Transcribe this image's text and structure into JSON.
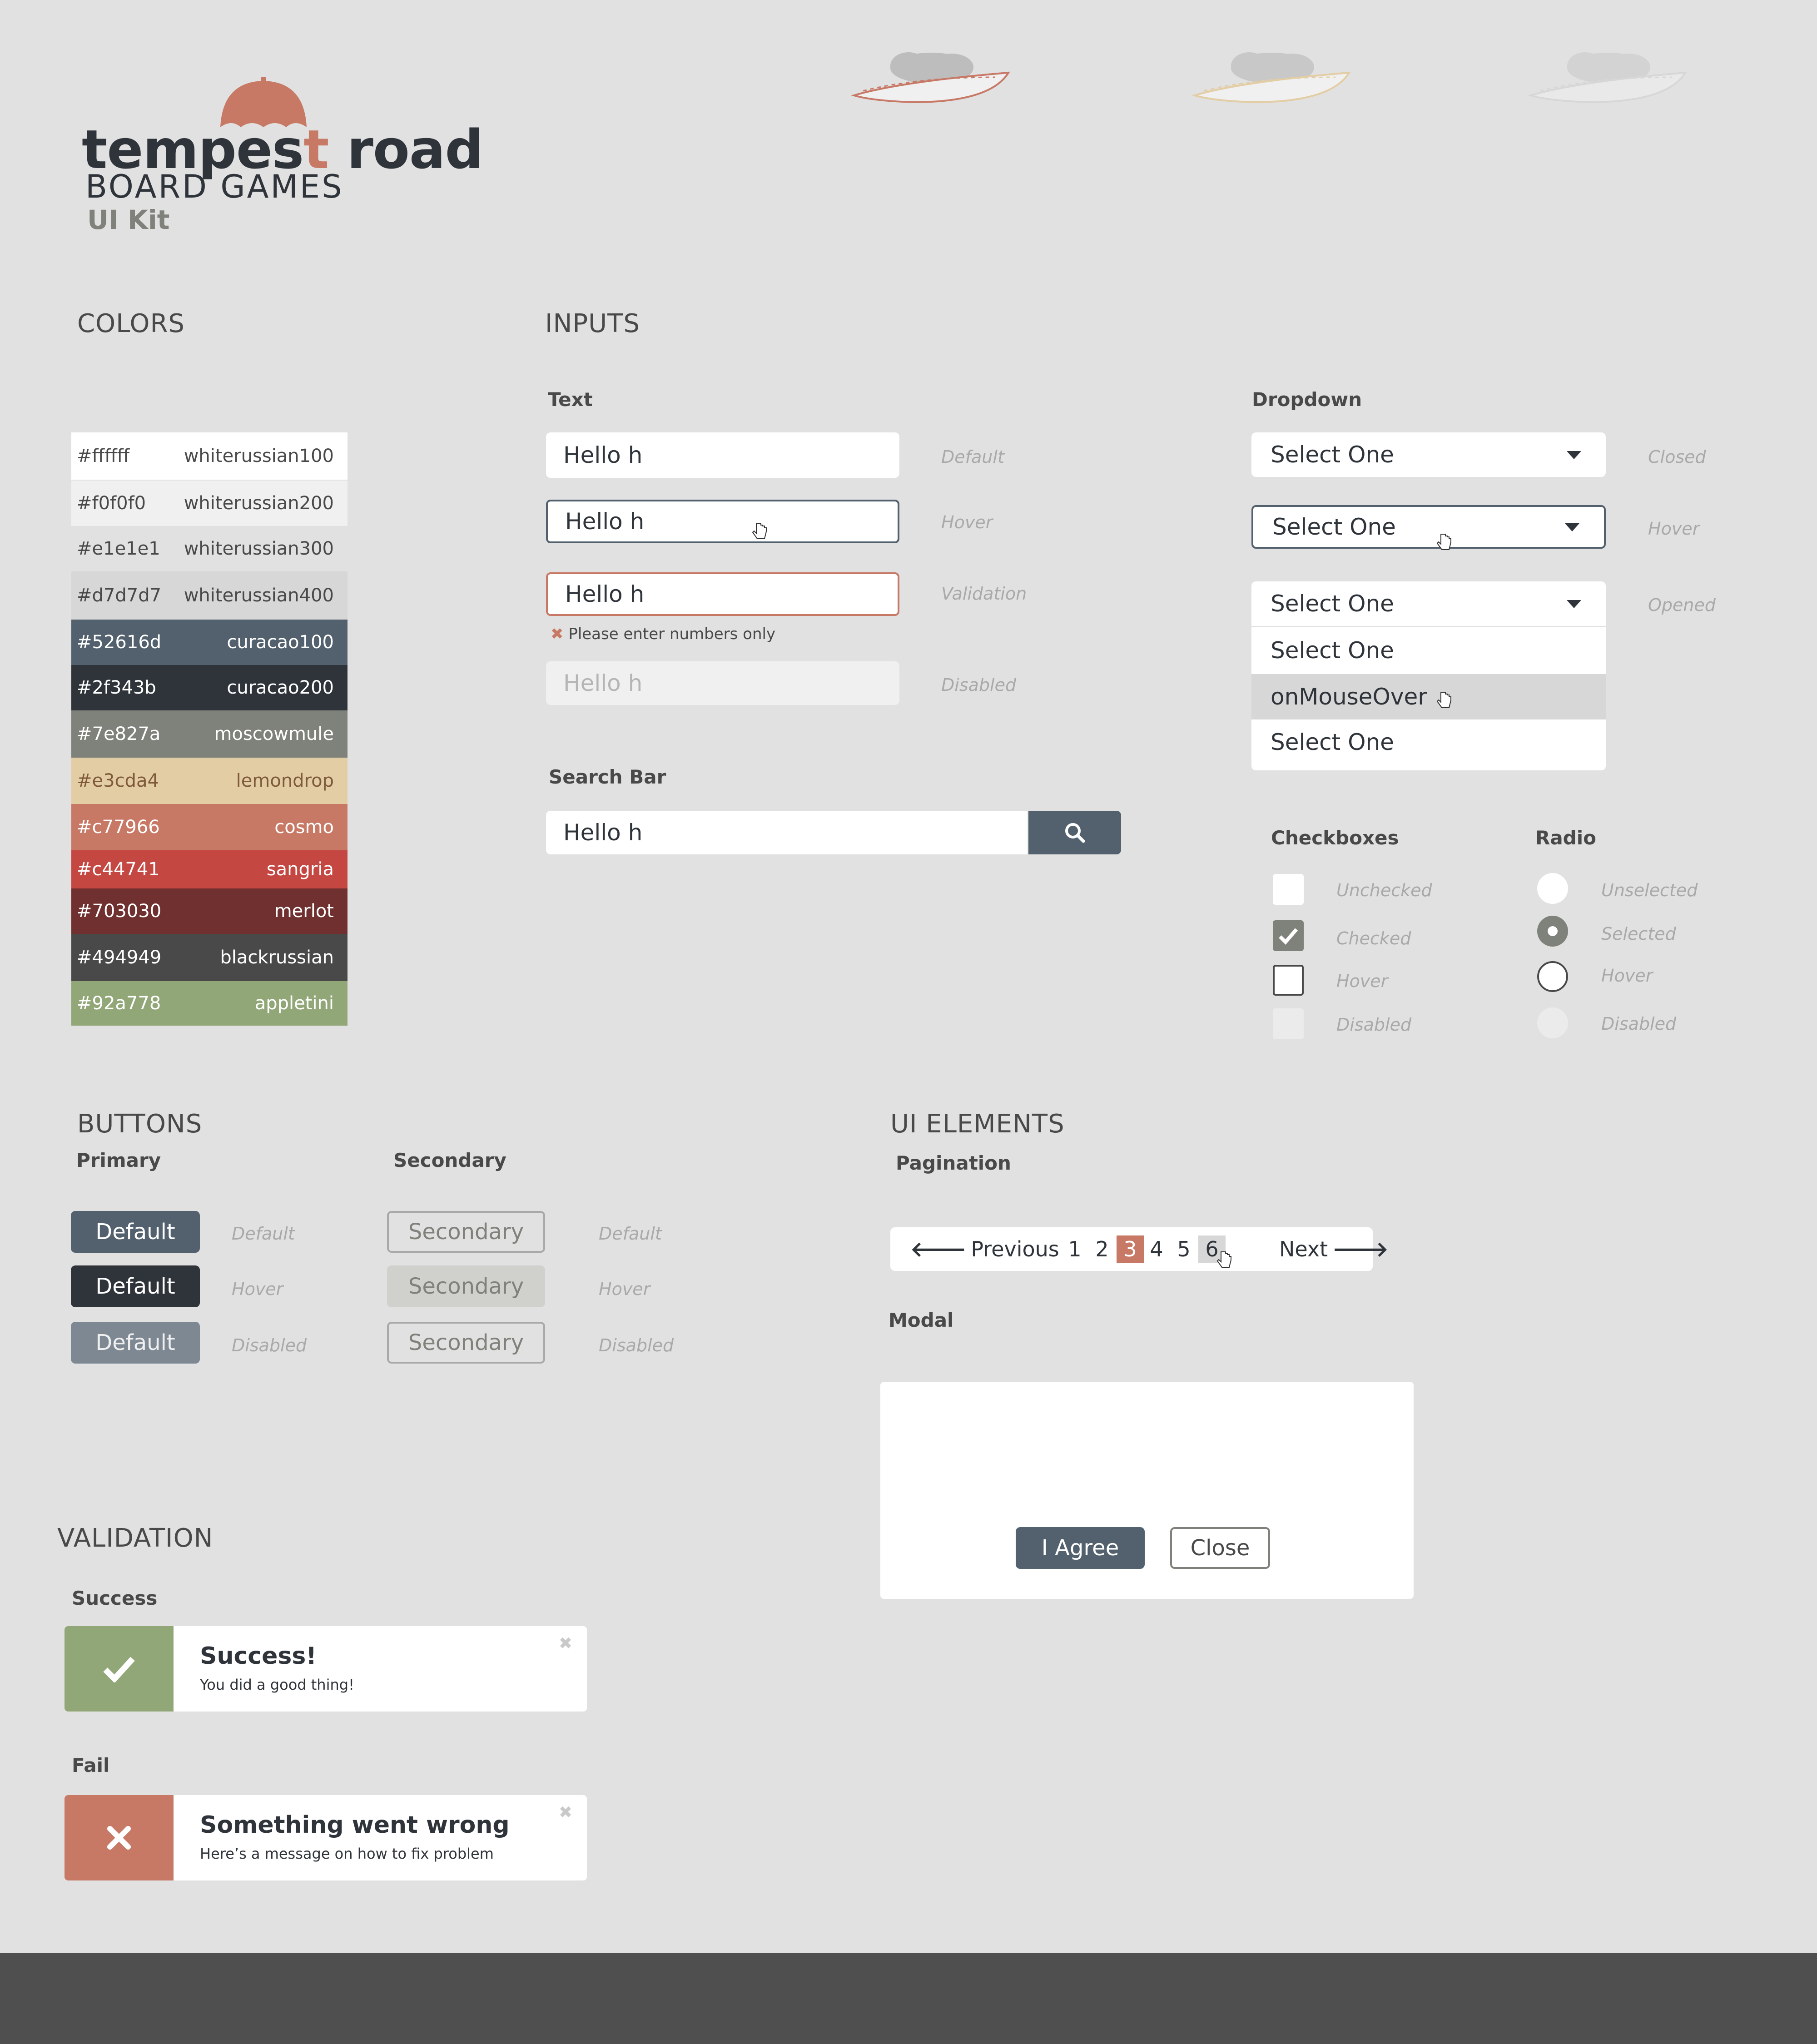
{
  "logo": {
    "brand_part1": "tempes",
    "brand_t": "t",
    "brand_part2": " road",
    "subtitle": "BOARD GAMES",
    "kit": "UI Kit"
  },
  "colors": {
    "title": "COLORS",
    "swatches": [
      {
        "hex": "#ffffff",
        "name": "whiterussian100",
        "text_color": "#494949"
      },
      {
        "hex": "#f0f0f0",
        "name": "whiterussian200",
        "text_color": "#494949"
      },
      {
        "hex": "#e1e1e1",
        "name": "whiterussian300",
        "text_color": "#494949"
      },
      {
        "hex": "#d7d7d7",
        "name": "whiterussian400",
        "text_color": "#494949"
      },
      {
        "hex": "#52616d",
        "name": "curacao100",
        "text_color": "#ffffff"
      },
      {
        "hex": "#2f343b",
        "name": "curacao200",
        "text_color": "#ffffff"
      },
      {
        "hex": "#7e827a",
        "name": "moscowmule",
        "text_color": "#ffffff"
      },
      {
        "hex": "#e3cda4",
        "name": "lemondrop",
        "text_color": "#7e5a3a"
      },
      {
        "hex": "#c77966",
        "name": "cosmo",
        "text_color": "#ffffff"
      },
      {
        "hex": "#c44741",
        "name": "sangria",
        "text_color": "#ffffff"
      },
      {
        "hex": "#703030",
        "name": "merlot",
        "text_color": "#ffffff"
      },
      {
        "hex": "#494949",
        "name": "blackrussian",
        "text_color": "#ffffff"
      },
      {
        "hex": "#92a778",
        "name": "appletini",
        "text_color": "#ffffff"
      }
    ]
  },
  "inputs": {
    "title": "INPUTS",
    "text_label": "Text",
    "text_value": "Hello h",
    "states": {
      "default": "Default",
      "hover": "Hover",
      "validation": "Validation",
      "disabled": "Disabled"
    },
    "validation_message": "Please enter numbers only",
    "search_label": "Search Bar",
    "search_value": "Hello h"
  },
  "dropdown": {
    "label": "Dropdown",
    "value": "Select One",
    "states": {
      "closed": "Closed",
      "hover": "Hover",
      "opened": "Opened"
    },
    "options": [
      "Select One",
      "onMouseOver",
      "Select One"
    ]
  },
  "checkboxes": {
    "label": "Checkboxes",
    "states": [
      "Unchecked",
      "Checked",
      "Hover",
      "Disabled"
    ]
  },
  "radio": {
    "label": "Radio",
    "states": [
      "Unselected",
      "Selected",
      "Hover",
      "Disabled"
    ]
  },
  "buttons": {
    "title": "BUTTONS",
    "primary_label": "Primary",
    "secondary_label": "Secondary",
    "primary_text": "Default",
    "secondary_text": "Secondary",
    "states": {
      "default": "Default",
      "hover": "Hover",
      "disabled": "Disabled"
    }
  },
  "ui_elements": {
    "title": "UI ELEMENTS",
    "pagination_label": "Pagination",
    "pagination": {
      "previous": "Previous",
      "pages": [
        "1",
        "2",
        "3",
        "4",
        "5",
        "6"
      ],
      "current": "3",
      "hovered": "6",
      "next": "Next"
    },
    "modal_label": "Modal",
    "modal": {
      "agree": "I Agree",
      "close": "Close"
    }
  },
  "validation": {
    "title": "VALIDATION",
    "success_label": "Success",
    "success_title": "Success!",
    "success_message": "You did a good thing!",
    "fail_label": "Fail",
    "fail_title": "Something went wrong",
    "fail_message": "Here’s a message on how to fix problem"
  }
}
